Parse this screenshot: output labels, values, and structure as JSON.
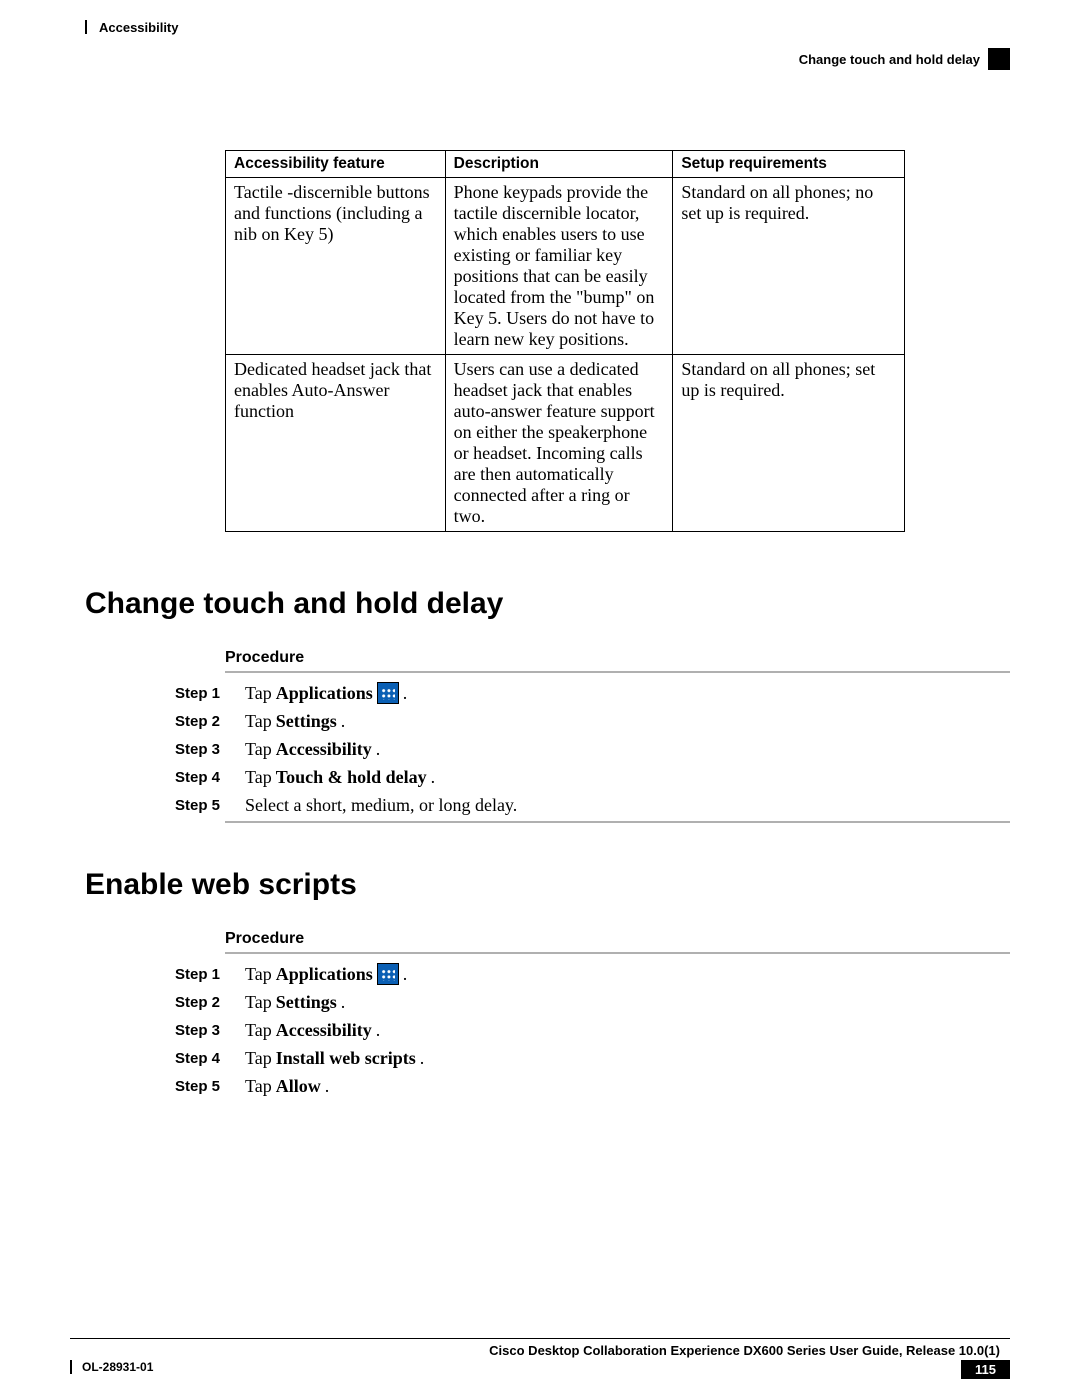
{
  "header": {
    "left": "Accessibility",
    "right": "Change touch and hold delay"
  },
  "table": {
    "headers": [
      "Accessibility feature",
      "Description",
      "Setup requirements"
    ],
    "rows": [
      {
        "feature": "Tactile -discernible buttons and functions (including a nib on Key 5)",
        "description": "Phone keypads provide the tactile discernible locator, which enables users to use existing or familiar key positions that can be easily located from the \"bump\" on Key 5. Users do not have to learn new key positions.",
        "setup": "Standard on all phones; no set up is required."
      },
      {
        "feature": "Dedicated headset jack that enables Auto-Answer function",
        "description": "Users can use a dedicated headset jack that enables auto-answer feature support on either the speakerphone or headset. Incoming calls are then automatically connected after a ring or two.",
        "setup": "Standard on all phones; set up is required."
      }
    ]
  },
  "section1": {
    "title": "Change touch and hold delay",
    "procedure_label": "Procedure",
    "steps": [
      {
        "label": "Step 1",
        "prefix": "Tap ",
        "bold": "Applications",
        "suffix": " ",
        "icon": true,
        "trail": "."
      },
      {
        "label": "Step 2",
        "prefix": "Tap ",
        "bold": "Settings",
        "suffix": ".",
        "icon": false,
        "trail": ""
      },
      {
        "label": "Step 3",
        "prefix": "Tap ",
        "bold": "Accessibility",
        "suffix": ".",
        "icon": false,
        "trail": ""
      },
      {
        "label": "Step 4",
        "prefix": "Tap ",
        "bold": "Touch & hold delay",
        "suffix": ".",
        "icon": false,
        "trail": ""
      },
      {
        "label": "Step 5",
        "prefix": "Select a short, medium, or long delay.",
        "bold": "",
        "suffix": "",
        "icon": false,
        "trail": ""
      }
    ]
  },
  "section2": {
    "title": "Enable web scripts",
    "procedure_label": "Procedure",
    "steps": [
      {
        "label": "Step 1",
        "prefix": "Tap ",
        "bold": "Applications",
        "suffix": " ",
        "icon": true,
        "trail": "."
      },
      {
        "label": "Step 2",
        "prefix": "Tap ",
        "bold": "Settings",
        "suffix": ".",
        "icon": false,
        "trail": ""
      },
      {
        "label": "Step 3",
        "prefix": "Tap ",
        "bold": "Accessibility",
        "suffix": ".",
        "icon": false,
        "trail": ""
      },
      {
        "label": "Step 4",
        "prefix": "Tap ",
        "bold": "Install web scripts",
        "suffix": ".",
        "icon": false,
        "trail": ""
      },
      {
        "label": "Step 5",
        "prefix": "Tap ",
        "bold": "Allow",
        "suffix": ".",
        "icon": false,
        "trail": ""
      }
    ]
  },
  "footer": {
    "title": "Cisco Desktop Collaboration Experience DX600 Series User Guide, Release 10.0(1)",
    "code": "OL-28931-01",
    "page": "115"
  }
}
